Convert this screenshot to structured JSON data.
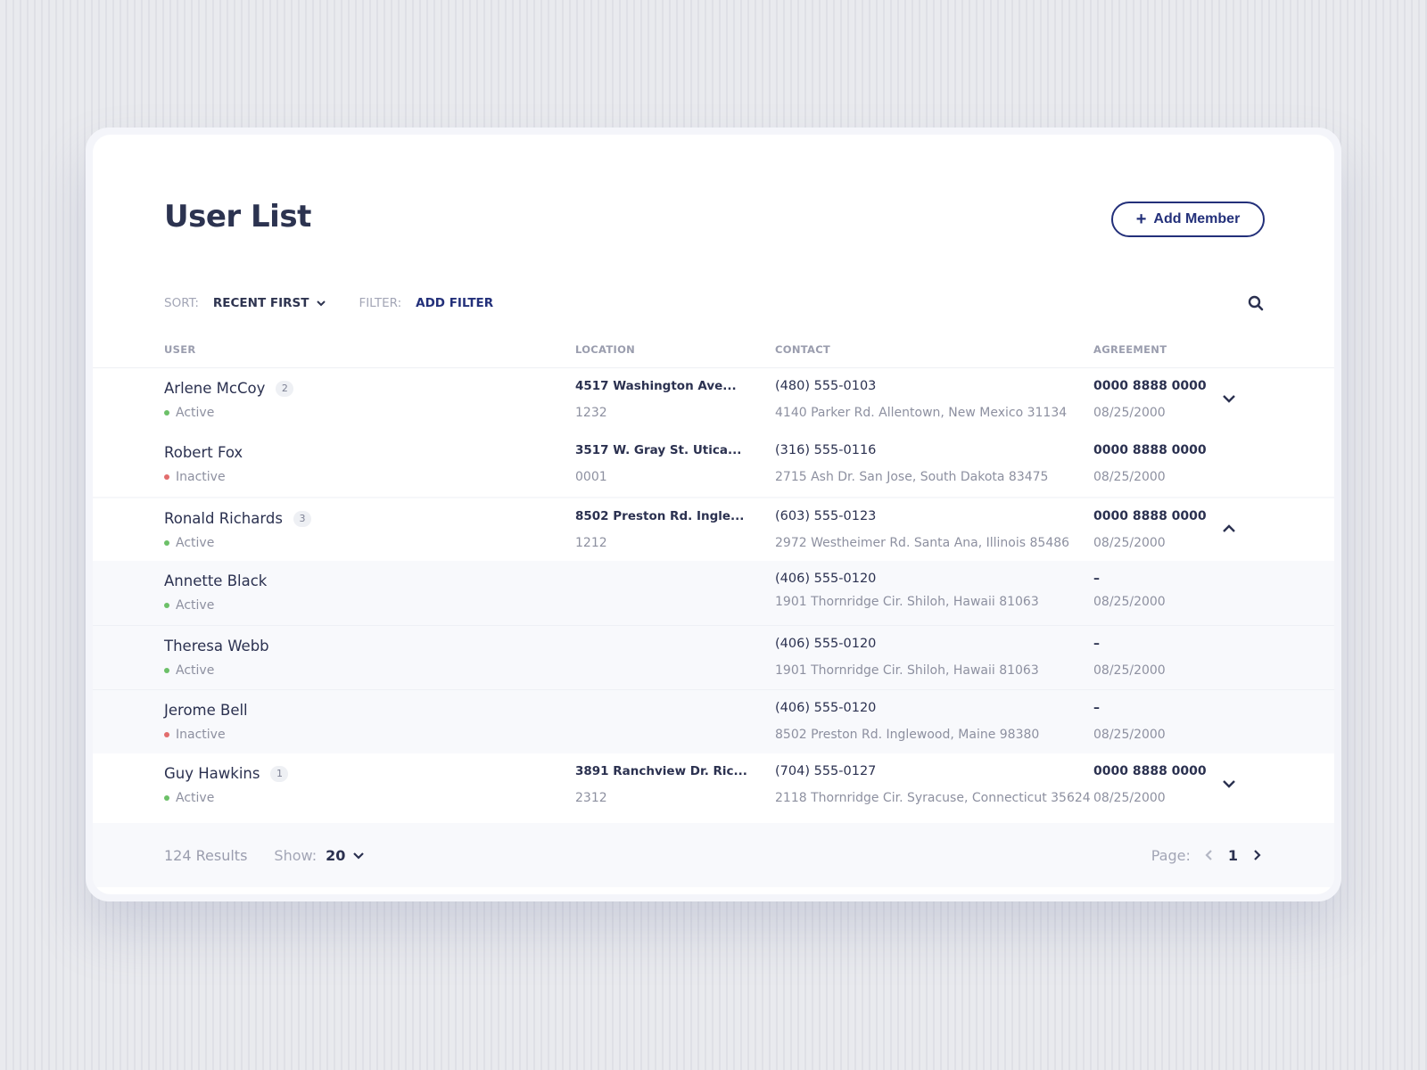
{
  "page": {
    "title": "User List"
  },
  "actions": {
    "add_member": "Add Member"
  },
  "toolbar": {
    "sort_label": "SORT:",
    "sort_value": "RECENT FIRST",
    "filter_label": "FILTER:",
    "filter_value": "ADD FILTER"
  },
  "columns": {
    "user": "USER",
    "location": "LOCATION",
    "contact": "CONTACT",
    "agreement": "AGREEMENT"
  },
  "rows": [
    {
      "name": "Arlene McCoy",
      "count": "2",
      "status": "Active",
      "location": "4517 Washington Ave...",
      "location_code": "1232",
      "phone": "(480) 555-0103",
      "address": "4140 Parker Rd. Allentown, New Mexico 31134",
      "agreement": "0000 8888 0000",
      "date": "08/25/2000",
      "expanded": false
    },
    {
      "name": "Robert Fox",
      "count": "",
      "status": "Inactive",
      "location": "3517 W. Gray St. Utica...",
      "location_code": "0001",
      "phone": "(316) 555-0116",
      "address": "2715 Ash Dr. San Jose, South Dakota 83475",
      "agreement": "0000 8888 0000",
      "date": "08/25/2000"
    },
    {
      "name": "Ronald Richards",
      "count": "3",
      "status": "Active",
      "location": "8502 Preston Rd. Ingle...",
      "location_code": "1212",
      "phone": "(603) 555-0123",
      "address": "2972 Westheimer Rd. Santa Ana, Illinois 85486",
      "agreement": "0000 8888 0000",
      "date": "08/25/2000",
      "expanded": true
    },
    {
      "name": "Annette Black",
      "status": "Active",
      "phone": "(406) 555-0120",
      "address": "1901 Thornridge Cir. Shiloh, Hawaii 81063",
      "agreement": "–",
      "date": "08/25/2000"
    },
    {
      "name": "Theresa Webb",
      "status": "Active",
      "phone": "(406) 555-0120",
      "address": "1901 Thornridge Cir. Shiloh, Hawaii 81063",
      "agreement": "–",
      "date": "08/25/2000"
    },
    {
      "name": "Jerome Bell",
      "status": "Inactive",
      "phone": "(406) 555-0120",
      "address": "8502 Preston Rd. Inglewood, Maine 98380",
      "agreement": "–",
      "date": "08/25/2000"
    },
    {
      "name": "Guy Hawkins",
      "count": "1",
      "status": "Active",
      "location": "3891 Ranchview Dr. Ric...",
      "location_code": "2312",
      "phone": "(704) 555-0127",
      "address": "2118 Thornridge Cir. Syracuse, Connecticut 35624",
      "agreement": "0000 8888 0000",
      "date": "08/25/2000",
      "expanded": false
    }
  ],
  "footer": {
    "results": "124 Results",
    "show_label": "Show:",
    "show_value": "20",
    "page_label": "Page:",
    "page_value": "1"
  },
  "colors": {
    "accent": "#23307a",
    "active": "#6cc068",
    "inactive": "#e26d6d"
  }
}
